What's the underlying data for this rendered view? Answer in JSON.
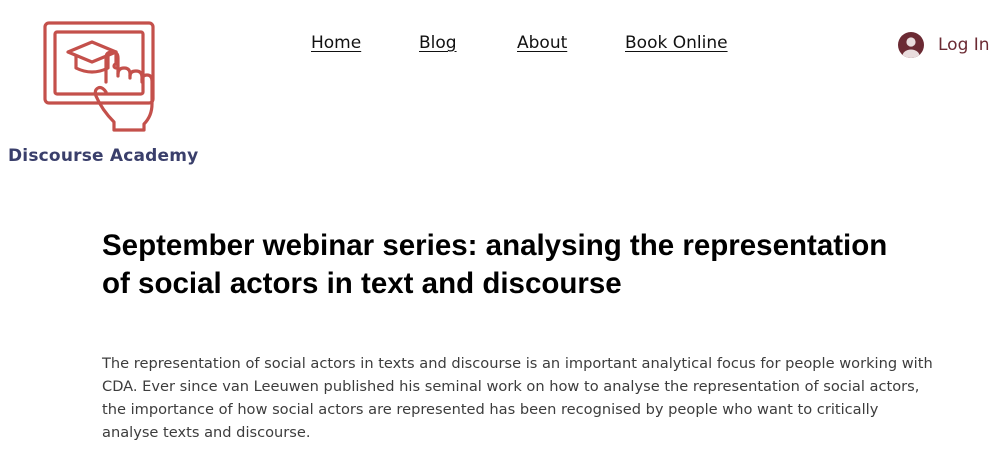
{
  "brand": {
    "name": "Discourse Academy",
    "logo_icon": "graduation-cap-tablet-pointer-icon",
    "logo_color": "#c4504b",
    "name_color": "#3a3f6b"
  },
  "nav": {
    "items": [
      {
        "label": "Home"
      },
      {
        "label": "Blog"
      },
      {
        "label": "About"
      },
      {
        "label": "Book Online"
      }
    ]
  },
  "login": {
    "label": "Log In",
    "icon": "user-avatar-icon",
    "color": "#6b2a33"
  },
  "post": {
    "title": "September webinar series: analysing the representation of social actors in text and discourse",
    "body": "The representation of social actors in texts and discourse is an important analytical focus for people working with CDA. Ever since van Leeuwen published his seminal work on how to analyse the representation of social actors, the importance of how social actors are represented has been recognised by people who want to critically analyse texts and discourse."
  }
}
